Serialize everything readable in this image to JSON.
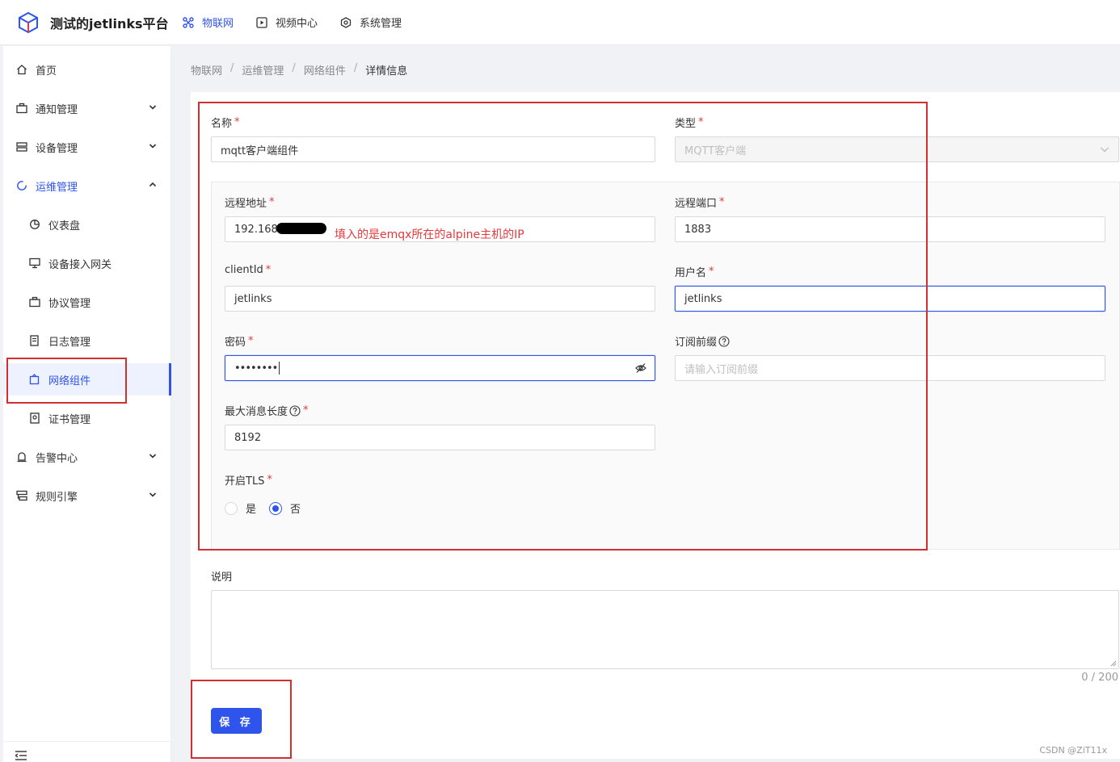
{
  "app": {
    "title": "测试的jetlinks平台"
  },
  "topnav": [
    {
      "label": "物联网",
      "active": true
    },
    {
      "label": "视频中心",
      "active": false
    },
    {
      "label": "系统管理",
      "active": false
    }
  ],
  "sidebar": {
    "items": [
      {
        "label": "首页"
      },
      {
        "label": "通知管理"
      },
      {
        "label": "设备管理"
      },
      {
        "label": "运维管理"
      },
      {
        "label": "仪表盘"
      },
      {
        "label": "设备接入网关"
      },
      {
        "label": "协议管理"
      },
      {
        "label": "日志管理"
      },
      {
        "label": "网络组件"
      },
      {
        "label": "证书管理"
      },
      {
        "label": "告警中心"
      },
      {
        "label": "规则引擎"
      }
    ]
  },
  "breadcrumb": [
    "物联网",
    "运维管理",
    "网络组件",
    "详情信息"
  ],
  "breadcrumb_sep": "/",
  "form": {
    "name_label": "名称",
    "name_value": "mqtt客户端组件",
    "type_label": "类型",
    "type_value": "MQTT客户端",
    "remote_addr_label": "远程地址",
    "remote_addr_value": "192.168.",
    "remote_port_label": "远程端口",
    "remote_port_value": "1883",
    "clientid_label": "clientId",
    "clientid_value": "jetlinks",
    "username_label": "用户名",
    "username_value": "jetlinks",
    "password_label": "密码",
    "password_value": "••••••••",
    "topic_prefix_label": "订阅前缀",
    "topic_prefix_placeholder": "请输入订阅前缀",
    "max_msg_label": "最大消息长度",
    "max_msg_value": "8192",
    "tls_label": "开启TLS",
    "tls_yes": "是",
    "tls_no": "否",
    "tls_selected": "否",
    "desc_label": "说明",
    "desc_counter": "0 / 200",
    "required_mark": "*",
    "save_label": "保 存"
  },
  "annotation": "填入的是emqx所在的alpine主机的IP",
  "watermark": "CSDN @ZiT11x",
  "colors": {
    "primary": "#2f54eb",
    "annotation_red": "#d32f2f",
    "required": "#e4393c"
  }
}
